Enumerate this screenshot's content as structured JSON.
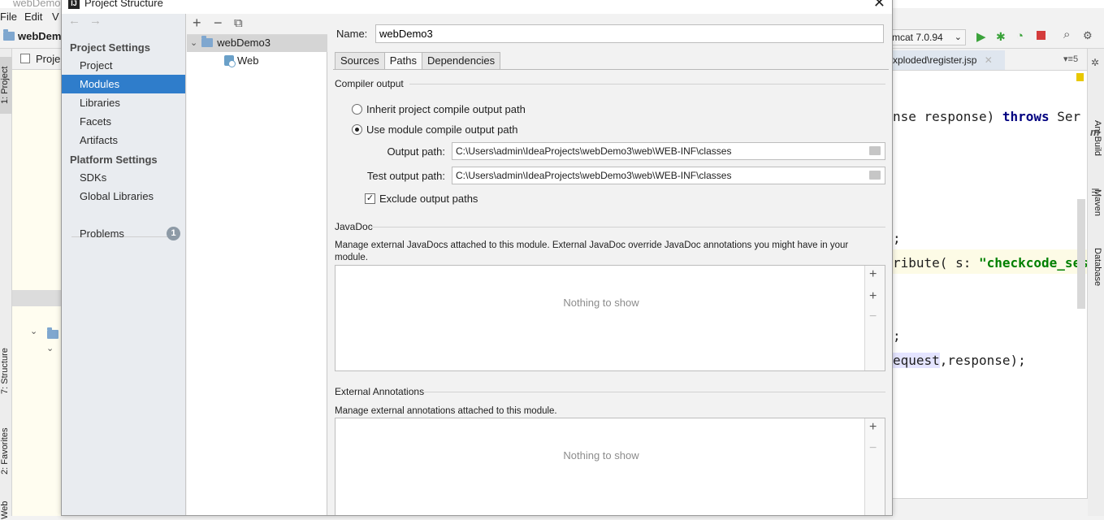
{
  "ide": {
    "window_title": "webDemo",
    "menu": [
      "File",
      "Edit",
      "V"
    ],
    "project_crumb": "webDem",
    "project_tab": "Proje",
    "run_config": "mcat 7.0.94",
    "editor_tab": "xploded\\register.jsp",
    "editor_tab_count": "5",
    "left_tabs": [
      "1: Project",
      "7: Structure",
      "2: Favorites",
      "Web"
    ],
    "right_tabs": [
      "Ant Build",
      "Maven",
      "Database"
    ],
    "code_lines": [
      {
        "pre": "nse response) ",
        "kw": "throws",
        "post": " Ser"
      },
      {
        "pre": ";",
        "kw": "",
        "post": ""
      },
      {
        "pre": "ribute( s: ",
        "str": "\"checkcode_ses",
        "kw": "",
        "post": ""
      },
      {
        "pre": ";",
        "kw": "",
        "post": ""
      },
      {
        "pre": "equest",
        "kw": "",
        "post": ",response);"
      }
    ],
    "colors": {
      "keyword": "#000080",
      "string": "#008000",
      "accent": "#2f7dcb"
    }
  },
  "dialog": {
    "title": "Project Structure",
    "nav": {
      "back_icon": "arrow-left",
      "forward_icon": "arrow-right",
      "project_settings_header": "Project Settings",
      "project_settings_items": [
        "Project",
        "Modules",
        "Libraries",
        "Facets",
        "Artifacts"
      ],
      "selected": "Modules",
      "platform_settings_header": "Platform Settings",
      "platform_settings_items": [
        "SDKs",
        "Global Libraries"
      ],
      "problems_label": "Problems",
      "problems_count": "1"
    },
    "tree": {
      "toolbar": [
        "+",
        "−",
        "⧉"
      ],
      "root": "webDemo3",
      "child": "Web"
    },
    "content": {
      "name_label": "Name:",
      "name_value": "webDemo3",
      "tabs": [
        "Sources",
        "Paths",
        "Dependencies"
      ],
      "active_tab": "Paths",
      "compiler_output_title": "Compiler output",
      "radio_inherit": "Inherit project compile output path",
      "radio_module": "Use module compile output path",
      "radio_selected": "module",
      "output_path_label": "Output path:",
      "output_path_value": "C:\\Users\\admin\\IdeaProjects\\webDemo3\\web\\WEB-INF\\classes",
      "test_output_path_label": "Test output path:",
      "test_output_path_value": "C:\\Users\\admin\\IdeaProjects\\webDemo3\\web\\WEB-INF\\classes",
      "exclude_label": "Exclude output paths",
      "exclude_checked": true,
      "javadoc_title": "JavaDoc",
      "javadoc_desc": "Manage external JavaDocs attached to this module. External JavaDoc override JavaDoc annotations you might have in your module.",
      "javadoc_empty": "Nothing to show",
      "ext_annotations_title": "External Annotations",
      "ext_annotations_desc": "Manage external annotations attached to this module.",
      "ext_annotations_empty": "Nothing to show"
    }
  }
}
